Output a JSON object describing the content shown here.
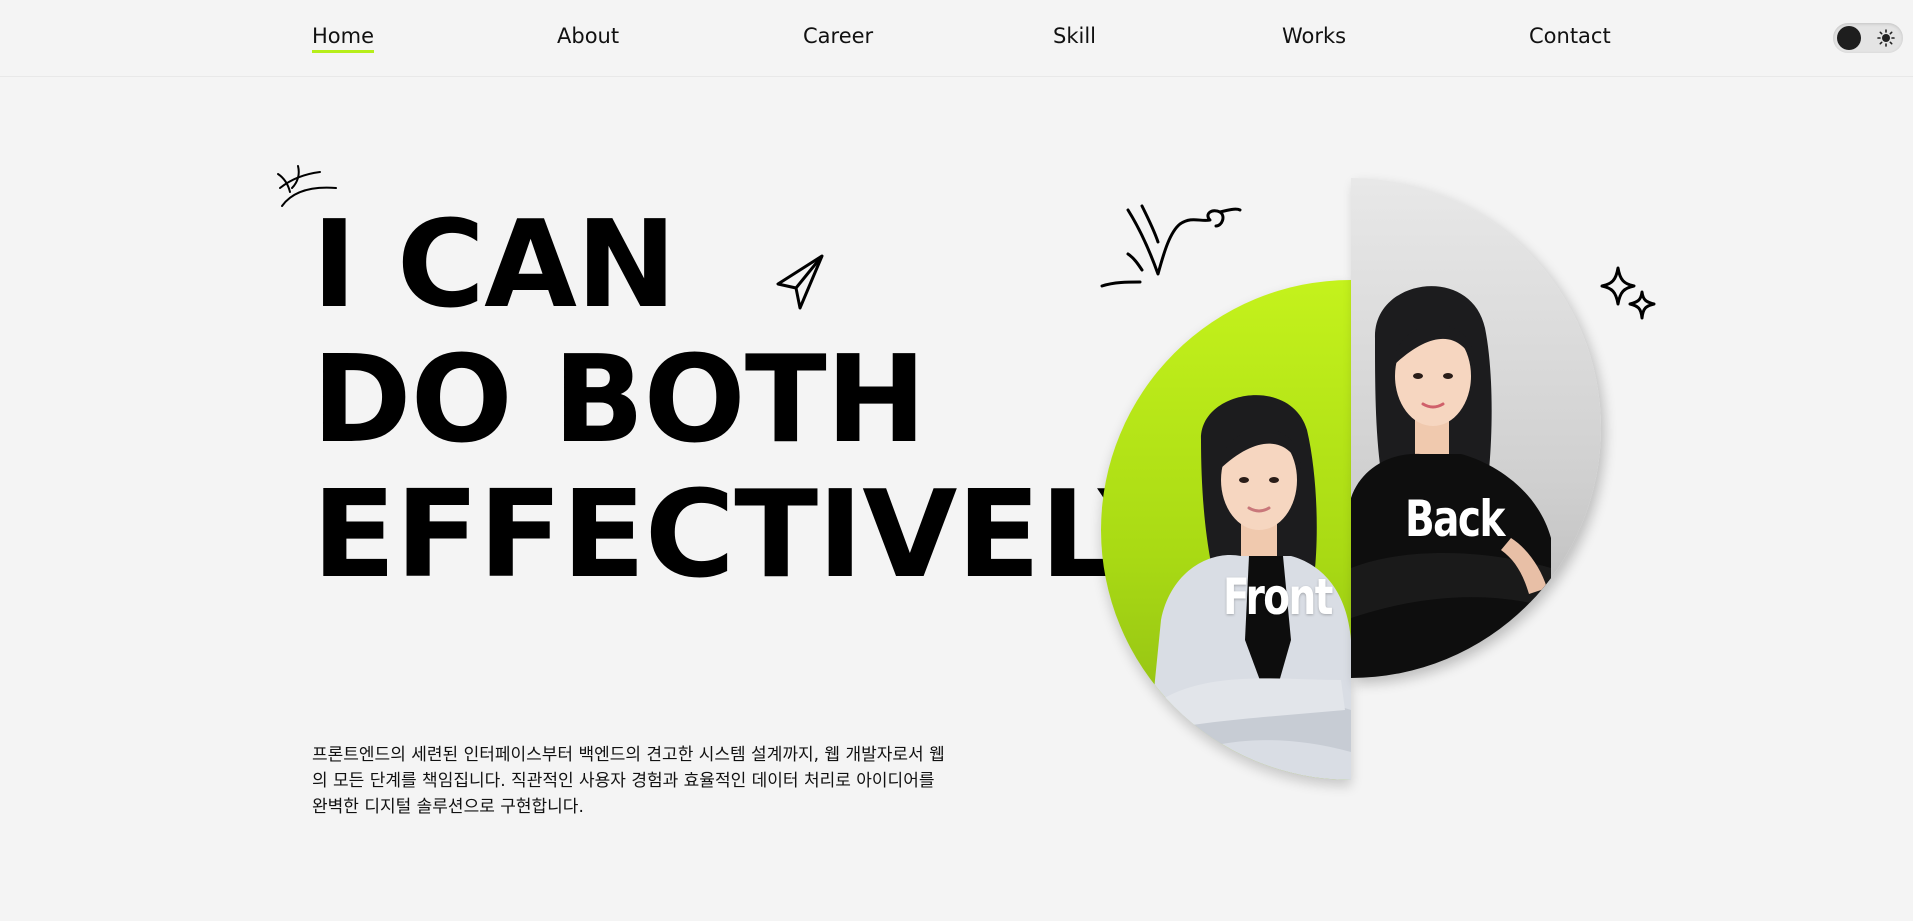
{
  "nav": {
    "items": [
      {
        "label": "Home"
      },
      {
        "label": "About"
      },
      {
        "label": "Career"
      },
      {
        "label": "Skill"
      },
      {
        "label": "Works"
      },
      {
        "label": "Contact"
      }
    ],
    "active_item": "Home",
    "theme_toggle": {
      "state": "dark",
      "icons": [
        "moon-knob-icon",
        "sun-icon"
      ]
    }
  },
  "hero": {
    "headline_lines": [
      "I CAN",
      "DO BOTH",
      "EFFECTIVELY"
    ],
    "description": "프론트엔드의 세련된 인터페이스부터 백엔드의 견고한 시스템 설계까지, 웹 개발자로서 웹의 모든 단계를 책임집니다. 직관적인 사용자 경험과 효율적인 데이터 처리로 아이디어를 완벽한 디지털 솔루션으로 구현합니다."
  },
  "portrait": {
    "front_label": "Front",
    "back_label": "Back"
  },
  "colors": {
    "accent": "#b6ee1a",
    "background": "#f4f4f4",
    "text": "#000000"
  }
}
